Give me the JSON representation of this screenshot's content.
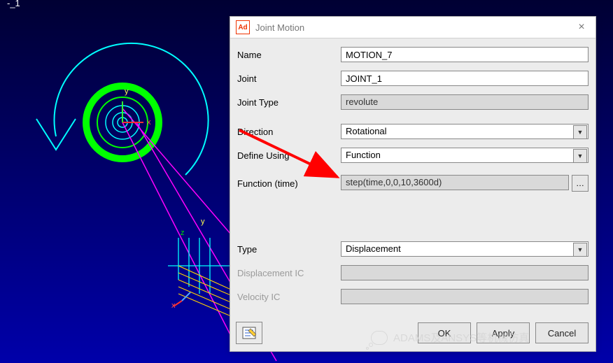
{
  "viewport": {
    "top_label": "-_1"
  },
  "dialog": {
    "title": "Joint Motion",
    "fields": {
      "name": {
        "label": "Name",
        "value": "MOTION_7"
      },
      "joint": {
        "label": "Joint",
        "value": "JOINT_1"
      },
      "joint_type": {
        "label": "Joint Type",
        "value": "revolute"
      },
      "direction": {
        "label": "Direction",
        "value": "Rotational"
      },
      "define_using": {
        "label": "Define Using",
        "value": "Function"
      },
      "function_time": {
        "label": "Function (time)",
        "value": "step(time,0,0,10,3600d)"
      },
      "type": {
        "label": "Type",
        "value": "Displacement"
      },
      "disp_ic": {
        "label": "Displacement IC",
        "value": ""
      },
      "vel_ic": {
        "label": "Velocity IC",
        "value": ""
      }
    },
    "buttons": {
      "ok": "OK",
      "apply": "Apply",
      "cancel": "Cancel"
    }
  },
  "watermark": {
    "text": "ADAMS及ANSYS等机械仿真"
  }
}
